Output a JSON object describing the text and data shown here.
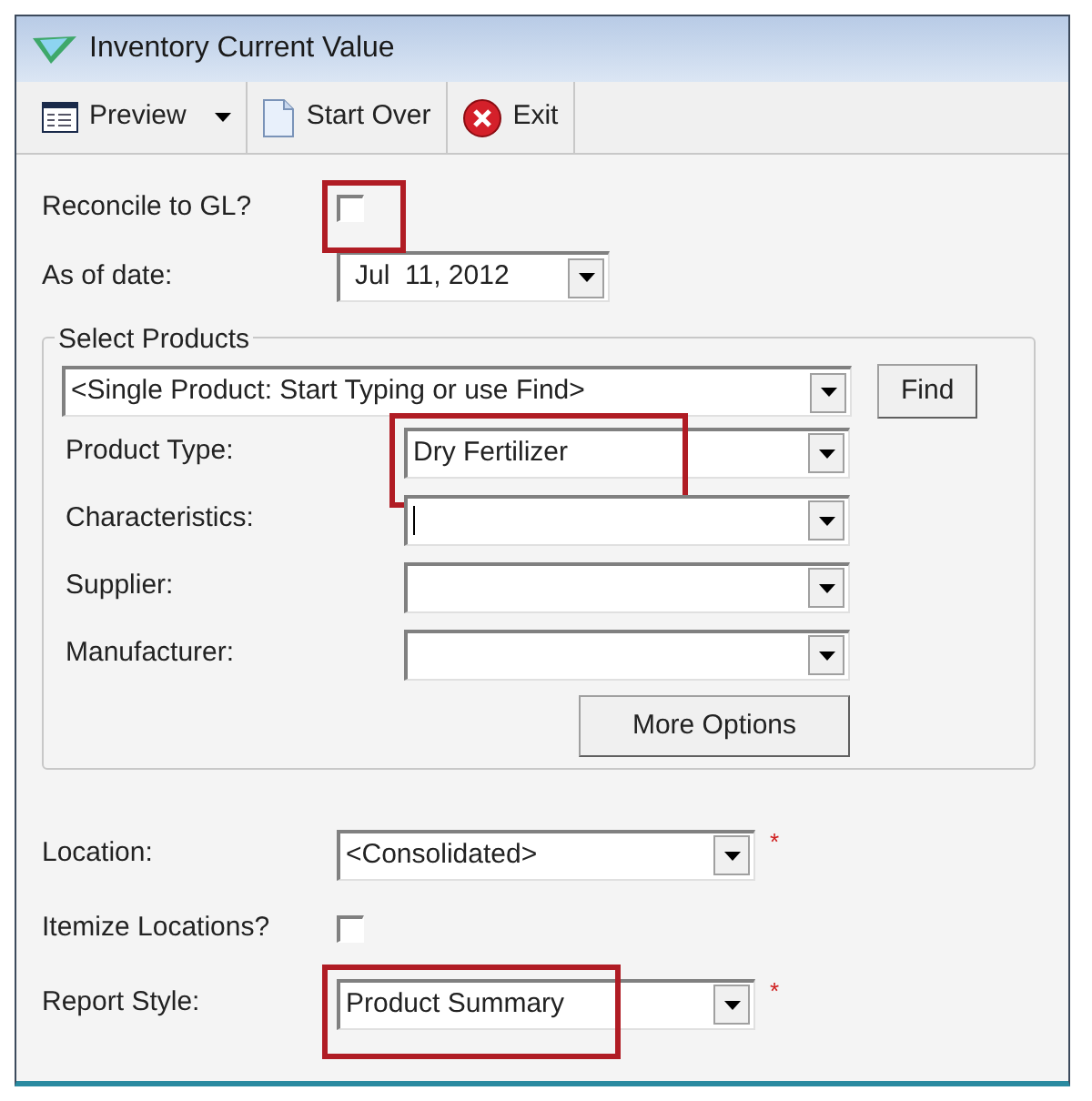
{
  "window": {
    "title": "Inventory Current Value"
  },
  "toolbar": [
    {
      "label": "Preview",
      "kind": "report",
      "dropdown": true
    },
    {
      "label": "Start Over",
      "kind": "document",
      "dropdown": false
    },
    {
      "label": "Exit",
      "kind": "close",
      "dropdown": false
    }
  ],
  "top_fields": [
    {
      "kind": "checkbox",
      "label": "Reconcile to GL?",
      "checked": false,
      "highlighted": true
    },
    {
      "kind": "date",
      "label": "As of date:",
      "value": "Jul  11, 2012"
    }
  ],
  "select_products": {
    "title": "Select Products",
    "single_product": {
      "value": "<Single Product: Start Typing or use Find>"
    },
    "find_button": "Find",
    "fields": [
      {
        "label": "Product Type:",
        "value": "Dry Fertilizer",
        "highlighted": true,
        "focused": false
      },
      {
        "label": "Characteristics:",
        "highlighted": false,
        "focused": true
      },
      {
        "label": "Supplier:",
        "highlighted": false,
        "focused": false
      },
      {
        "label": "Manufacturer:",
        "highlighted": false,
        "focused": false
      }
    ],
    "more_options_button": "More Options"
  },
  "bottom_fields": [
    {
      "kind": "combo",
      "label": "Location:",
      "value": "<Consolidated>",
      "required_mark": "*",
      "highlighted": false
    },
    {
      "kind": "checkbox",
      "label": "Itemize Locations?",
      "checked": false,
      "highlighted": false
    },
    {
      "kind": "combo",
      "label": "Report Style:",
      "value": "Product Summary",
      "required_mark": "*",
      "highlighted": true
    }
  ]
}
